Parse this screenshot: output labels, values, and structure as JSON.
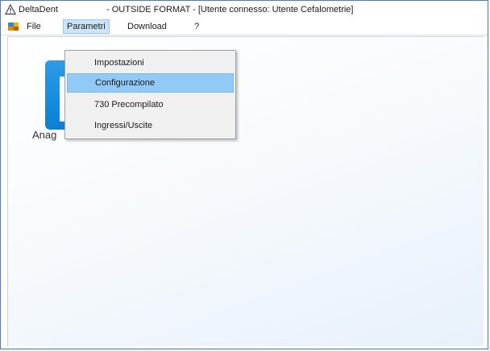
{
  "window": {
    "app_name": "DeltaDent",
    "title_rest": "- OUTSIDE FORMAT - [Utente connesso: Utente Cefalometrie]",
    "title_icon": "warning-triangle-icon"
  },
  "menubar": {
    "app_icon": "app-menu-icon",
    "items": [
      {
        "label": "File"
      },
      {
        "label": "Parametri"
      },
      {
        "label": "Download"
      },
      {
        "label": "?"
      }
    ]
  },
  "dropdown": {
    "items": [
      {
        "label": "Impostazioni"
      },
      {
        "label": "Configurazione"
      },
      {
        "label": "730 Precompilato"
      },
      {
        "label": "Ingressi/Uscite"
      }
    ],
    "highlighted_index": 1
  },
  "shortcut": {
    "label": "Anag",
    "icon": "anagrafica-icon"
  },
  "colors": {
    "highlight": "#91c9f7",
    "tile": "#1b8ddc",
    "frame": "#4a7db8"
  }
}
